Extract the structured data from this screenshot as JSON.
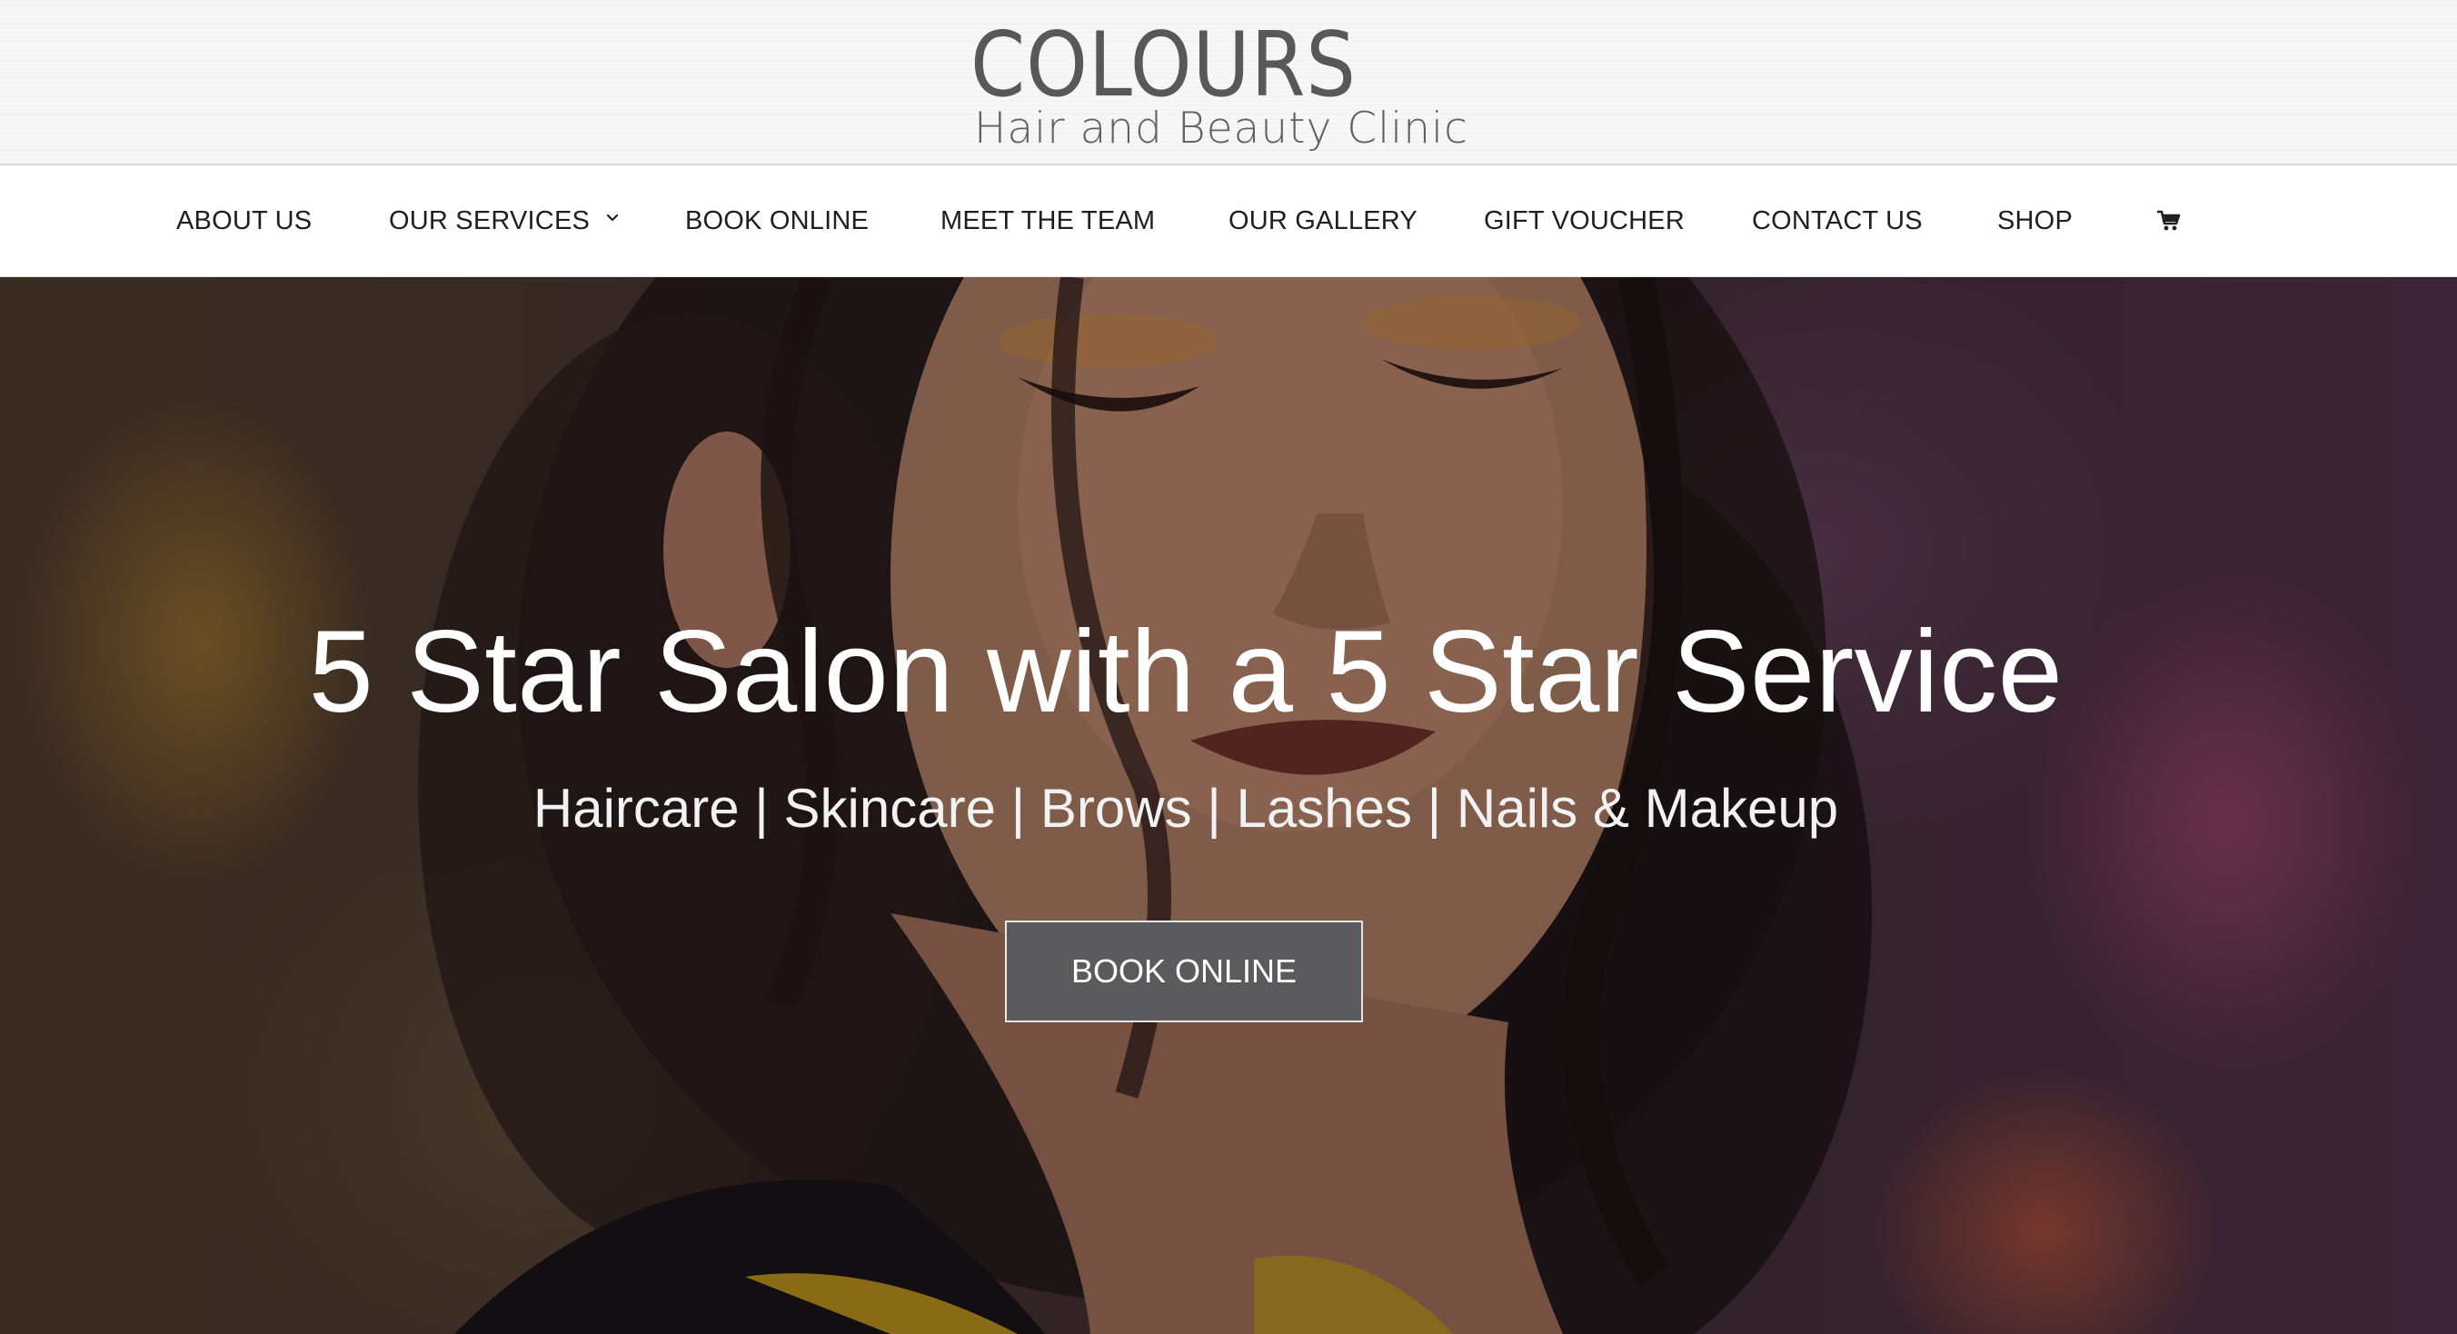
{
  "brand": {
    "name": "COLOURS",
    "tagline": "Hair and Beauty Clinic",
    "text_color": "#585858"
  },
  "nav": {
    "items": [
      {
        "label": "ABOUT US"
      },
      {
        "label": "OUR SERVICES",
        "has_dropdown": true,
        "dropdown_icon": "chevron-down-icon"
      },
      {
        "label": "BOOK ONLINE"
      },
      {
        "label": "MEET THE TEAM"
      },
      {
        "label": "OUR GALLERY"
      },
      {
        "label": "GIFT VOUCHER"
      },
      {
        "label": "CONTACT US"
      },
      {
        "label": "SHOP"
      }
    ],
    "cart_icon": "cart-icon",
    "text_color": "#1f1f1f"
  },
  "hero": {
    "title": "5 Star Salon with a 5 Star Service",
    "subtitle": "Haircare | Skincare | Brows | Lashes | Nails & Makeup",
    "button_label": "BOOK ONLINE",
    "button_color": "#5b5b5e"
  }
}
